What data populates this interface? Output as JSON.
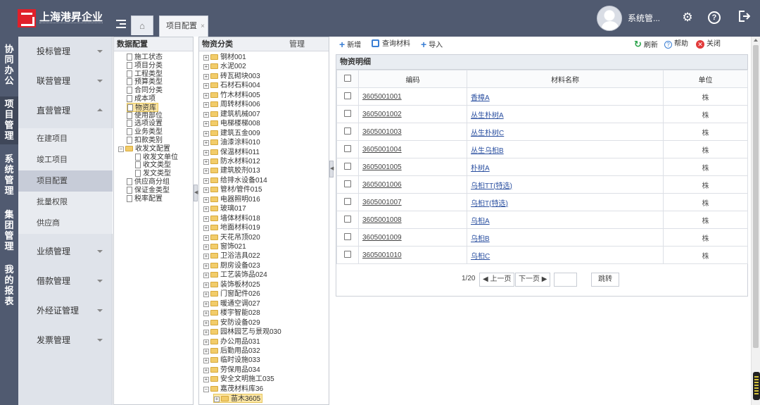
{
  "header": {
    "logo_text": "上海港昇企业",
    "tabs": [
      {
        "label": "项目配置",
        "close": "×"
      }
    ],
    "user_name": "系统管...",
    "icons": [
      "gear-icon",
      "help-icon",
      "logout-icon"
    ]
  },
  "vnav": [
    {
      "label": "协同办公",
      "chars": [
        "协",
        "同",
        "办",
        "公"
      ]
    },
    {
      "label": "项目管理",
      "chars": [
        "项",
        "目",
        "管",
        "理"
      ]
    },
    {
      "label": "系统管理",
      "chars": [
        "系",
        "统",
        "管",
        "理"
      ]
    },
    {
      "label": "集团管理",
      "chars": [
        "集",
        "团",
        "管",
        "理"
      ]
    },
    {
      "label": "我的报表",
      "chars": [
        "我",
        "的",
        "报",
        "表"
      ]
    }
  ],
  "sidebar": {
    "items": [
      {
        "label": "投标管理"
      },
      {
        "label": "联营管理"
      },
      {
        "label": "直营管理"
      },
      {
        "label": "业绩管理"
      },
      {
        "label": "借款管理"
      },
      {
        "label": "外经证管理"
      },
      {
        "label": "发票管理"
      }
    ],
    "subitems": [
      {
        "label": "在建项目"
      },
      {
        "label": "竣工项目"
      },
      {
        "label": "项目配置"
      },
      {
        "label": "批量权限"
      },
      {
        "label": "供应商"
      }
    ]
  },
  "data_config": {
    "title": "数据配置",
    "nodes": [
      "施工状态",
      "项目分类",
      "工程类型",
      "预算类型",
      "合同分类",
      "成本项",
      "物资库",
      "使用部位",
      "选项设置",
      "业务类型",
      "扣款类别",
      "收发文配置",
      "收发文单位",
      "收文类型",
      "发文类型",
      "供应商分组",
      "保证金类型",
      "税率配置"
    ]
  },
  "category": {
    "title": "物资分类",
    "manage": "管理",
    "nodes": [
      "钢材001",
      "水泥002",
      "砖瓦砌块003",
      "石材石料004",
      "竹木材料005",
      "周转材料006",
      "建筑机械007",
      "电梯楼梯008",
      "建筑五金009",
      "油漆涂料010",
      "保温材料011",
      "防水材料012",
      "建筑胶剂013",
      "给排水设备014",
      "管材/管件015",
      "电器照明016",
      "玻璃017",
      "墙体材料018",
      "地面材料019",
      "天花吊顶020",
      "窗饰021",
      "卫浴洁具022",
      "厨房设备023",
      "工艺装饰品024",
      "装饰板材025",
      "门窗配件026",
      "暖通空调027",
      "楼宇智能028",
      "安防设备029",
      "园林园艺与景观030",
      "办公用品031",
      "后勤用品032",
      "临时设施033",
      "劳保用品034",
      "安全文明施工035",
      "嘉茂材料库36",
      "苗木3605"
    ]
  },
  "toolbar": {
    "add": "新增",
    "query": "查询材料",
    "import": "导入",
    "refresh": "刷新",
    "help": "帮助",
    "close": "关闭"
  },
  "grid": {
    "title": "物资明细",
    "columns": [
      "编码",
      "材料名称",
      "单位"
    ],
    "rows": [
      {
        "code": "3605001001",
        "name": "香樟A",
        "unit": "株"
      },
      {
        "code": "3605001002",
        "name": "丛生朴树A",
        "unit": "株"
      },
      {
        "code": "3605001003",
        "name": "丛生朴树C",
        "unit": "株"
      },
      {
        "code": "3605001004",
        "name": "丛生乌桕B",
        "unit": "株"
      },
      {
        "code": "3605001005",
        "name": "朴树A",
        "unit": "株"
      },
      {
        "code": "3605001006",
        "name": "乌桕TT(特选)",
        "unit": "株"
      },
      {
        "code": "3605001007",
        "name": "乌桕T(特选)",
        "unit": "株"
      },
      {
        "code": "3605001008",
        "name": "乌桕A",
        "unit": "株"
      },
      {
        "code": "3605001009",
        "name": "乌桕B",
        "unit": "株"
      },
      {
        "code": "3605001010",
        "name": "乌桕C",
        "unit": "株"
      }
    ]
  },
  "pager": {
    "info": "1/20",
    "prev": "◀ 上一页",
    "next": "下一页 ▶",
    "go": "跳转",
    "page_input": ""
  }
}
